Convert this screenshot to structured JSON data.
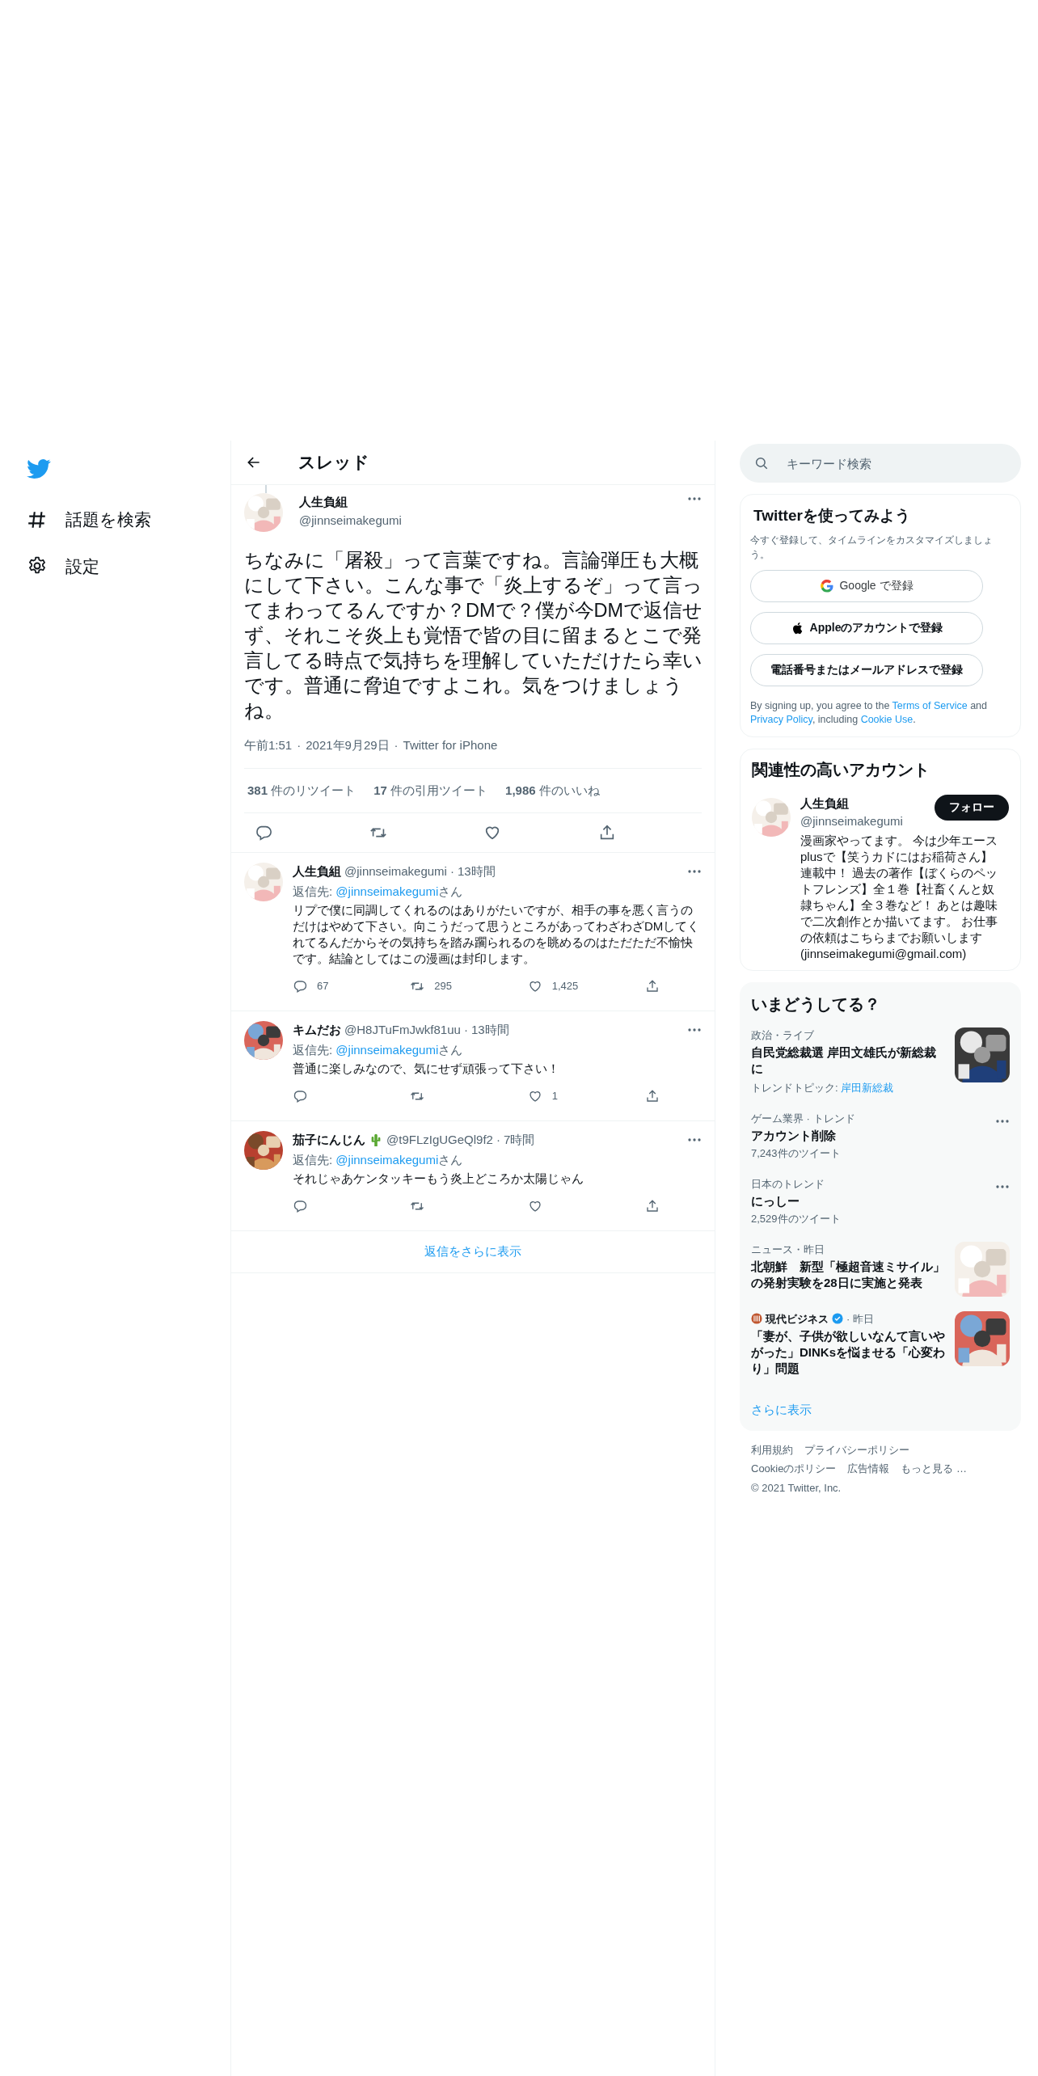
{
  "nav": {
    "items": [
      {
        "label": "話題を検索",
        "kind": "hashtag"
      },
      {
        "label": "設定",
        "kind": "settings"
      }
    ]
  },
  "header": {
    "title": "スレッド"
  },
  "main_tweet": {
    "name": "人生負組",
    "handle": "@jinnseimakegumi",
    "text": "ちなみに「屠殺」って言葉ですね。言論弾圧も大概にして下さい。こんな事で「炎上するぞ」って言ってまわってるんですか？DMで？僕が今DMで返信せず、それこそ炎上も覚悟で皆の目に留まるとこで発言してる時点で気持ちを理解していただけたら幸いです。普通に脅迫ですよこれ。気をつけましょうね。",
    "time": "午前1:51",
    "separator": "·",
    "date": "2021年9月29日",
    "source": "Twitter for iPhone",
    "stats": [
      "**381** 件のリツイート",
      "**17** 件の引用ツイート",
      "**1,986** 件のいいね"
    ]
  },
  "replies": [
    {
      "name": "人生負組",
      "handle": "@jinnseimakegumi",
      "separator": "·",
      "time": "13時間",
      "reply_prefix": "返信先: ",
      "reply_to": "@jinnseimakegumi",
      "reply_suffix": "さん",
      "text": "リプで僕に同調してくれるのはありがたいですが、相手の事を悪く言うのだけはやめて下さい。向こうだって思うところがあってわざわざDMしてくれてるんだからその気持ちを踏み躙られるのを眺めるのはただただ不愉快です。結論としてはこの漫画は封印します。",
      "replies": "67",
      "retweets": "295",
      "likes": "1,425"
    },
    {
      "name": "キムだお",
      "handle": "@H8JTuFmJwkf81uu",
      "separator": "·",
      "time": "13時間",
      "reply_prefix": "返信先: ",
      "reply_to": "@jinnseimakegumi",
      "reply_suffix": "さん",
      "text": "普通に楽しみなので、気にせず頑張って下さい！",
      "likes": "1"
    },
    {
      "name": "茄子にんじん",
      "cactus_badge": true,
      "handle": "@t9FLzIgUGeQl9f2",
      "separator": "·",
      "time": "7時間",
      "reply_prefix": "返信先: ",
      "reply_to": "@jinnseimakegumi",
      "reply_suffix": "さん",
      "text": "それじゃあケンタッキーもう炎上どころか太陽じゃん"
    }
  ],
  "show_more_replies": "返信をさらに表示",
  "search": {
    "placeholder": "キーワード検索"
  },
  "signup": {
    "title": "Twitterを使ってみよう",
    "subtitle": "今すぐ登録して、タイムラインをカスタマイズしましょう。",
    "buttons": [
      {
        "label": "Google で登録",
        "kind": "google"
      },
      {
        "label": "Appleのアカウントで登録",
        "kind": "apple"
      },
      {
        "label": "電話番号またはメールアドレスで登録",
        "kind": "plain"
      }
    ],
    "legal": [
      {
        "kind": "text",
        "text": "By signing up, you agree to the "
      },
      {
        "kind": "link",
        "text": "Terms of Service"
      },
      {
        "kind": "text",
        "text": " and "
      },
      {
        "kind": "link",
        "text": "Privacy Policy"
      },
      {
        "kind": "text",
        "text": ", including "
      },
      {
        "kind": "link",
        "text": "Cookie Use"
      },
      {
        "kind": "text",
        "text": "."
      }
    ]
  },
  "related": {
    "title": "関連性の高いアカウント",
    "name": "人生負組",
    "handle": "@jinnseimakegumi",
    "follow": "フォロー",
    "bio": "漫画家やってます。 今は少年エースplusで【笑うカドにはお稲荷さん】連載中！ 過去の著作【ぼくらのペットフレンズ】全１巻【社畜くんと奴隷ちゃん】全３巻など！ あとは趣味で二次創作とか描いてます。 お仕事の依頼はこちらまでお願いします(jinnseimakegumi@gmail.com)"
  },
  "trends": {
    "title": "いまどうしてる？",
    "items": [
      {
        "kind": "picture",
        "category": "政治・ライブ",
        "title": "自民党総裁選 岸田文雄氏が新総裁に",
        "topic_label": "トレンドトピック: ",
        "topic": "岸田新総裁"
      },
      {
        "kind": "menu",
        "category": "ゲーム業界 · トレンド",
        "title": "アカウント削除",
        "count": "7,243件のツイート"
      },
      {
        "kind": "menu",
        "category": "日本のトレンド",
        "title": "にっしー",
        "count": "2,529件のツイート"
      },
      {
        "kind": "picture",
        "category": "ニュース・昨日",
        "title": "北朝鮮　新型「極超音速ミサイル」の発射実験を28日に実施と発表"
      },
      {
        "kind": "picture",
        "source": "現代ビジネス",
        "verified": true,
        "time": "· 昨日",
        "title": "「妻が、子供が欲しいなんて言いやがった」DINKsを悩ませる「心変わり」問題"
      }
    ],
    "more": "さらに表示"
  },
  "footer": {
    "links": [
      "利用規約",
      "プライバシーポリシー",
      "Cookieのポリシー",
      "広告情報",
      "もっと見る …"
    ],
    "copyright": "© 2021 Twitter, Inc."
  }
}
